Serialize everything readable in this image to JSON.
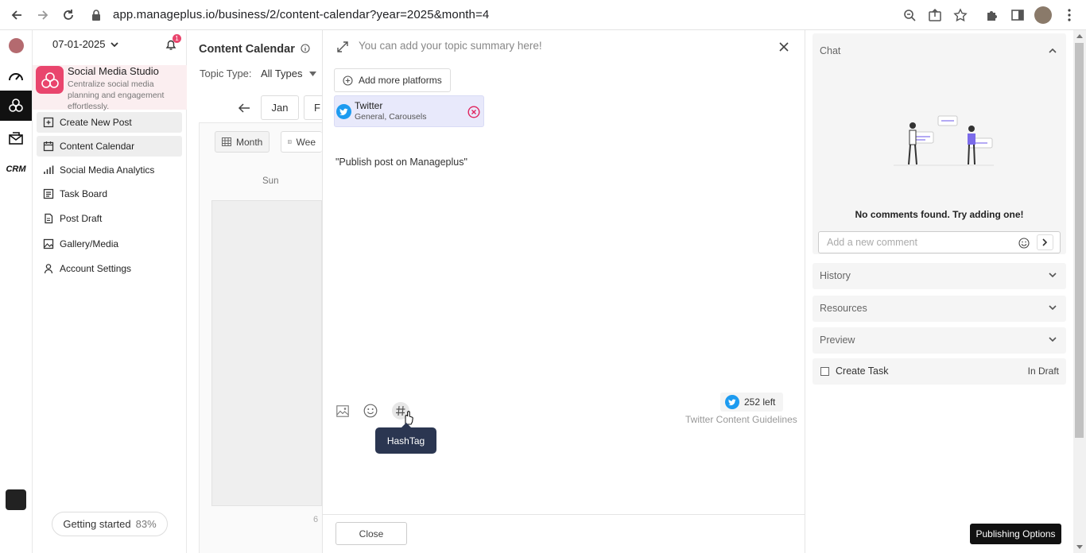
{
  "browser": {
    "url": "app.manageplus.io/business/2/content-calendar?year=2025&month=4"
  },
  "rail": {
    "notification_count": "1"
  },
  "sidebar": {
    "date": "07-01-2025",
    "studio_title": "Social Media Studio",
    "studio_desc": "Centralize social media planning and engagement effortlessly.",
    "items": [
      {
        "label": "Create New Post"
      },
      {
        "label": "Content Calendar"
      },
      {
        "label": "Social Media Analytics"
      },
      {
        "label": "Task Board"
      },
      {
        "label": "Post Draft"
      },
      {
        "label": "Gallery/Media"
      },
      {
        "label": "Account Settings"
      }
    ],
    "getting_started": "Getting started",
    "progress": "83%"
  },
  "calendar": {
    "title": "Content Calendar",
    "topic_label": "Topic Type:",
    "topic_value": "All Types",
    "month_jan": "Jan",
    "month_next": "F",
    "view_month": "Month",
    "view_week": "Wee",
    "day_sun": "Sun",
    "day_num": "6"
  },
  "editor": {
    "summary_placeholder": "You can add your topic summary here!",
    "add_platforms": "Add more platforms",
    "platform": {
      "name": "Twitter",
      "sub": "General, Carousels"
    },
    "post_text": "\"Publish post on Manageplus\"",
    "tooltip": "HashTag",
    "chars_left": "252 left",
    "guidelines": "Twitter Content Guidelines",
    "close": "Close"
  },
  "right_panel": {
    "chat_title": "Chat",
    "no_comments": "No comments found. Try adding one!",
    "comment_placeholder": "Add a new comment",
    "history": "History",
    "resources": "Resources",
    "preview": "Preview",
    "create_task": "Create Task",
    "task_status": "In Draft",
    "publishing_options": "Publishing Options"
  },
  "colors": {
    "brand_pink": "#e9456d",
    "twitter_blue": "#1d9bf0",
    "remove_red": "#e0245e",
    "tooltip_bg": "#2b3651"
  }
}
